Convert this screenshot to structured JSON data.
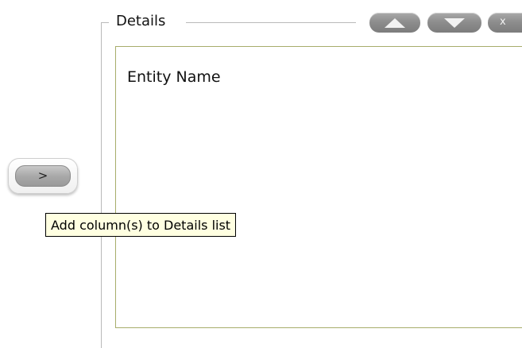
{
  "details_group": {
    "title": "Details",
    "buttons": {
      "move_up_icon": "triangle-up",
      "move_down_icon": "triangle-down",
      "close_label": "x"
    },
    "list_items": [
      "Entity Name"
    ]
  },
  "add_button": {
    "label": ">"
  },
  "tooltip": {
    "text": "Add column(s) to Details list"
  },
  "colors": {
    "panel_border": "#a7ad6b",
    "tooltip_bg": "#ffffe1",
    "button_gray": "#8e8e8e"
  }
}
